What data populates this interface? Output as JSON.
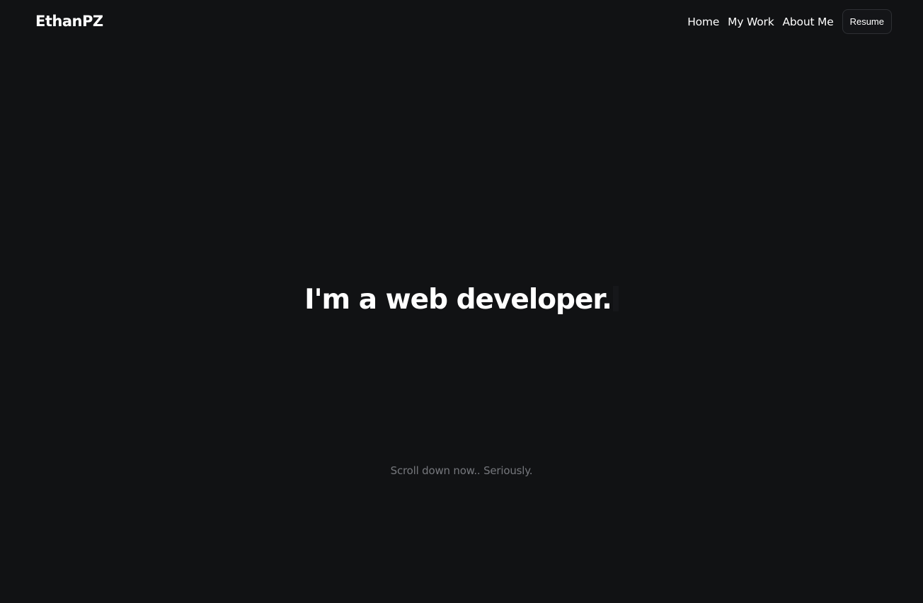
{
  "header": {
    "brand": "EthanPZ",
    "nav": {
      "home": "Home",
      "work": "My Work",
      "about": "About Me",
      "resume": "Resume"
    }
  },
  "hero": {
    "title": "I'm a web developer.",
    "scroll_hint": "Scroll down now.. Seriously."
  },
  "colors": {
    "background": "#111214",
    "text": "#ffffff",
    "muted_text": "#75777c",
    "button_border": "#2e3034"
  }
}
